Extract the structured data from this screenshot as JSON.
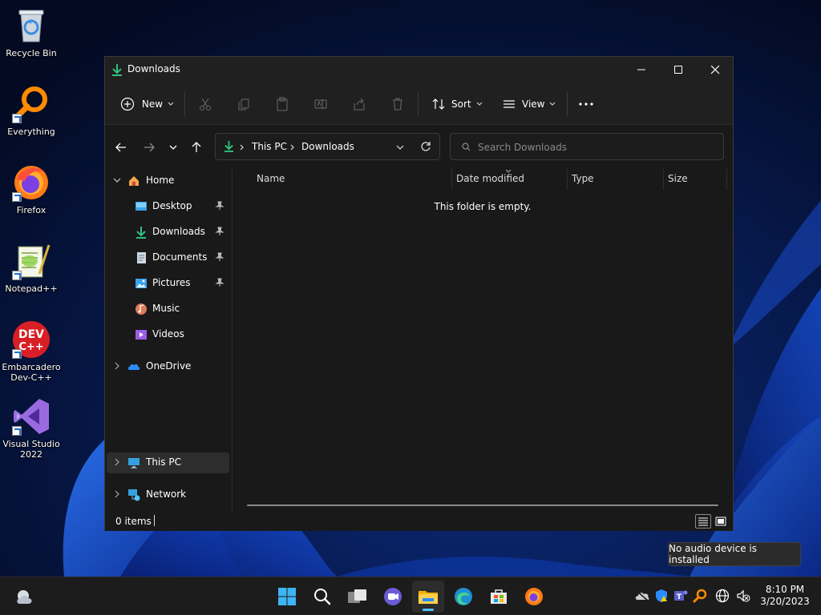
{
  "desktop": {
    "icons": [
      {
        "label": "Recycle Bin"
      },
      {
        "label": "Everything"
      },
      {
        "label": "Firefox"
      },
      {
        "label": "Notepad++"
      },
      {
        "label": "Embarcadero Dev-C++"
      },
      {
        "label": "Visual Studio 2022"
      }
    ]
  },
  "window": {
    "title": "Downloads",
    "toolbar": {
      "new_label": "New",
      "sort_label": "Sort",
      "view_label": "View"
    },
    "address": {
      "crumbs": [
        "This PC",
        "Downloads"
      ]
    },
    "search": {
      "placeholder": "Search Downloads"
    },
    "nav": {
      "home": "Home",
      "quick_access": [
        {
          "label": "Desktop",
          "pinned": true
        },
        {
          "label": "Downloads",
          "pinned": true
        },
        {
          "label": "Documents",
          "pinned": true
        },
        {
          "label": "Pictures",
          "pinned": true
        },
        {
          "label": "Music",
          "pinned": false
        },
        {
          "label": "Videos",
          "pinned": false
        }
      ],
      "onedrive": "OneDrive",
      "this_pc": "This PC",
      "network": "Network",
      "selected": "This PC"
    },
    "columns": [
      "Name",
      "Date modified",
      "Type",
      "Size"
    ],
    "empty_message": "This folder is empty.",
    "status": {
      "item_count": "0 items"
    }
  },
  "tooltip": "No audio device is installed",
  "taskbar": {
    "apps": [
      "start",
      "search",
      "task-view",
      "chat",
      "file-explorer",
      "edge",
      "store",
      "firefox"
    ],
    "active_app": "file-explorer",
    "clock": {
      "time": "8:10 PM",
      "date": "3/20/2023"
    }
  },
  "colors": {
    "accent": "#4cc2ff",
    "window_bg": "#191919",
    "toolbar_bg": "#202020",
    "taskbar_bg": "#1c1c1c"
  }
}
